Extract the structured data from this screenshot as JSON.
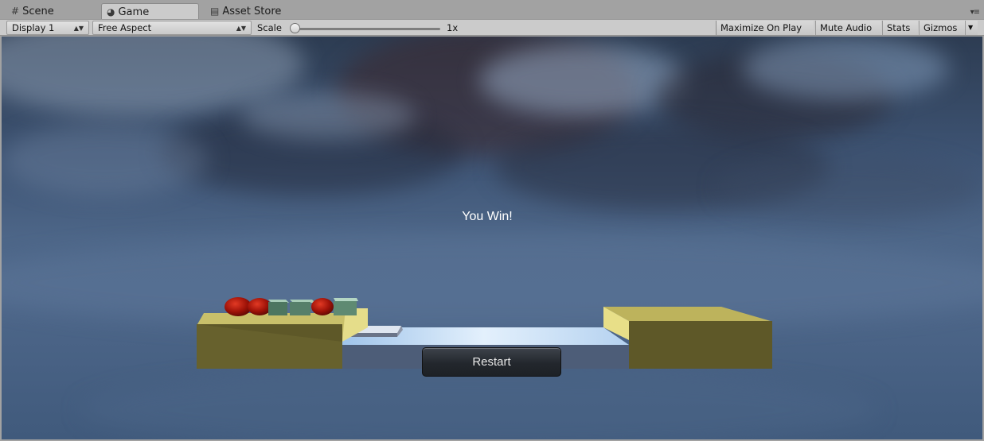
{
  "tabs": [
    {
      "label": "Scene",
      "icon": "grid-icon",
      "active": false
    },
    {
      "label": "Game",
      "icon": "pacman-icon",
      "active": true
    },
    {
      "label": "Asset Store",
      "icon": "store-icon",
      "active": false
    }
  ],
  "toolbar": {
    "display": "Display 1",
    "aspect": "Free Aspect",
    "scale_label": "Scale",
    "scale_value": "1x",
    "maximize": "Maximize On Play",
    "mute": "Mute Audio",
    "stats": "Stats",
    "gizmos": "Gizmos"
  },
  "game": {
    "message": "You Win!",
    "restart_label": "Restart"
  },
  "colors": {
    "platform_yellow": "#c9c06a",
    "bridge_blue": "#c8dcf2",
    "ball_red": "#b5150e",
    "cube_green": "#5f8a72"
  }
}
